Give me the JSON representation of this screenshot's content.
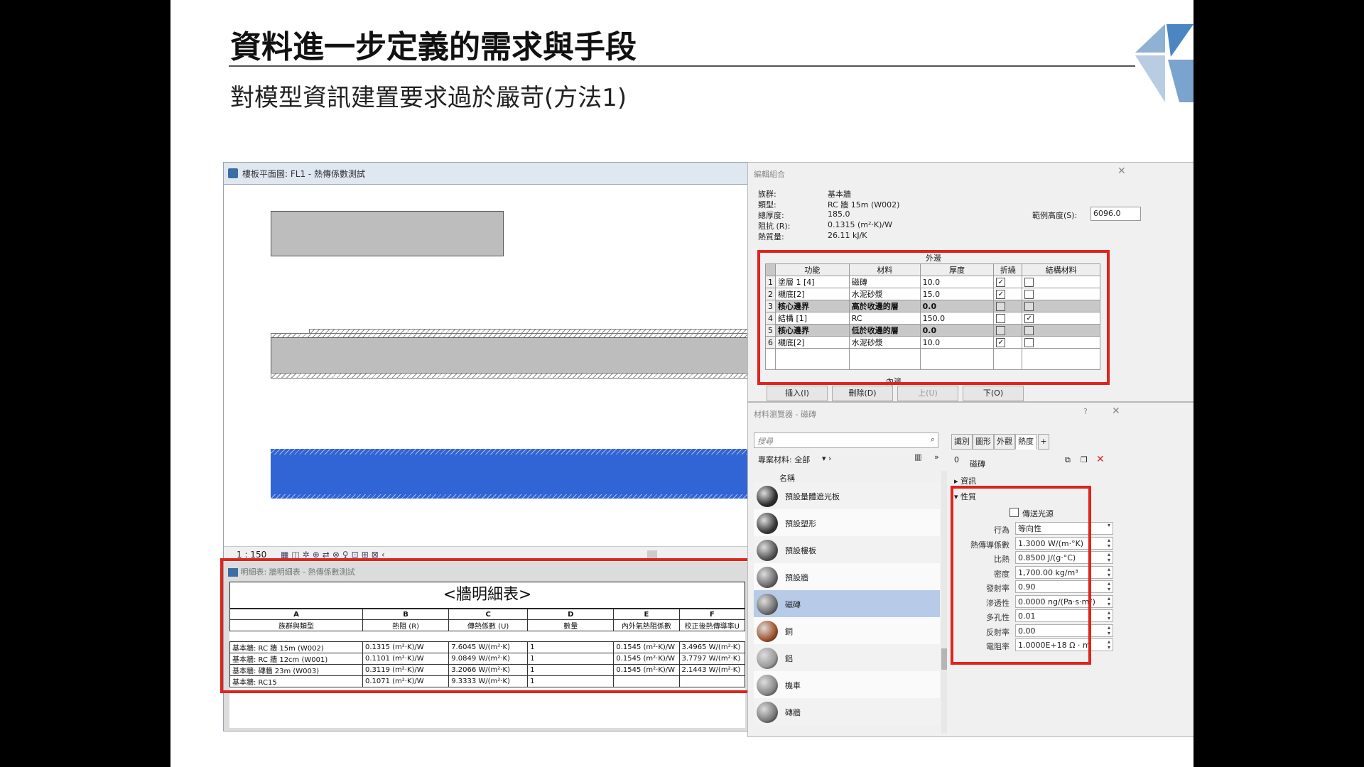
{
  "slide": {
    "title": "資料進一步定義的需求與手段",
    "subtitle": "對模型資訊建置要求過於嚴苛(方法1)"
  },
  "plan_view": {
    "title": "樓板平面圖: FL1 - 熱傳係數測試",
    "scale": "1 : 150"
  },
  "schedule": {
    "window_title": "明細表: 牆明細表 - 熱傳係數測試",
    "heading": "<牆明細表>",
    "col_letters": [
      "A",
      "B",
      "C",
      "D",
      "E",
      "F"
    ],
    "col_headers": [
      "族群與類型",
      "熱阻 (R)",
      "傳熱係數 (U)",
      "數量",
      "內外氣熱阻係數",
      "校正後熱傳導率U"
    ],
    "rows": [
      [
        "基本牆: RC 牆 15m (W002)",
        "0.1315 (m²·K)/W",
        "7.6045 W/(m²·K)",
        "1",
        "0.1545 (m²·K)/W",
        "3.4965 W/(m²·K)"
      ],
      [
        "基本牆: RC 牆 12cm (W001)",
        "0.1101 (m²·K)/W",
        "9.0849 W/(m²·K)",
        "1",
        "0.1545 (m²·K)/W",
        "3.7797 W/(m²·K)"
      ],
      [
        "基本牆: 磚牆 23m (W003)",
        "0.3119 (m²·K)/W",
        "3.2066 W/(m²·K)",
        "1",
        "0.1545 (m²·K)/W",
        "2.1443 W/(m²·K)"
      ],
      [
        "基本牆: RC15",
        "0.1071 (m²·K)/W",
        "9.3333 W/(m²·K)",
        "1",
        "",
        ""
      ]
    ]
  },
  "assembly": {
    "title": "編輯組合",
    "family_label": "族群:",
    "family_value": "基本牆",
    "type_label": "類型:",
    "type_value": "RC 牆 15m (W002)",
    "thickness_label": "總厚度:",
    "thickness_value": "185.0",
    "resistance_label": "阻抗 (R):",
    "resistance_value": "0.1315 (m²·K)/W",
    "mass_label": "熱質量:",
    "mass_value": "26.11 kJ/K",
    "sample_height_label": "範例高度(S):",
    "sample_height_value": "6096.0",
    "exterior_label": "外邊",
    "interior_label": "內邊",
    "headers": [
      "功能",
      "材料",
      "厚度",
      "折繞",
      "結構材料"
    ],
    "rows": [
      {
        "num": "1",
        "func": "塗層 1 [4]",
        "mat": "磁磚",
        "thk": "10.0",
        "wrap": true,
        "struct": false,
        "gray": false
      },
      {
        "num": "2",
        "func": "襯底[2]",
        "mat": "水泥砂漿",
        "thk": "15.0",
        "wrap": true,
        "struct": false,
        "gray": false
      },
      {
        "num": "3",
        "func": "核心邊界",
        "mat": "高於收邊的層",
        "thk": "0.0",
        "wrap": false,
        "struct": false,
        "gray": true
      },
      {
        "num": "4",
        "func": "結構 [1]",
        "mat": "RC",
        "thk": "150.0",
        "wrap": false,
        "struct": true,
        "gray": false
      },
      {
        "num": "5",
        "func": "核心邊界",
        "mat": "低於收邊的層",
        "thk": "0.0",
        "wrap": false,
        "struct": false,
        "gray": true
      },
      {
        "num": "6",
        "func": "襯底[2]",
        "mat": "水泥砂漿",
        "thk": "10.0",
        "wrap": true,
        "struct": false,
        "gray": false
      }
    ],
    "buttons": [
      "插入(I)",
      "刪除(D)",
      "上(U)",
      "下(O)"
    ]
  },
  "material_browser": {
    "title": "材料瀏覽器 - 磁磚",
    "search_placeholder": "搜尋",
    "filter_label": "專案材料: 全部",
    "list_header": "名稱",
    "items": [
      "預設量體遮光板",
      "預設塑形",
      "預設樓板",
      "預設牆",
      "磁磚",
      "銅",
      "鋁",
      "機車",
      "磚牆"
    ],
    "selected_index": 4,
    "tabs": [
      "識別",
      "圖形",
      "外觀",
      "熱度",
      "+"
    ],
    "active_tab": 3,
    "asset_name": "磁磚",
    "asset_count": "0",
    "section_info": "資訊",
    "section_props": "性質",
    "transmits_light": "傳送光源",
    "props": [
      {
        "label": "行為",
        "value": "等向性"
      },
      {
        "label": "熱傳導係數",
        "value": "1.3000 W/(m·°K)"
      },
      {
        "label": "比熱",
        "value": "0.8500 J/(g·°C)"
      },
      {
        "label": "密度",
        "value": "1,700.00 kg/m³"
      },
      {
        "label": "發射率",
        "value": "0.90"
      },
      {
        "label": "滲透性",
        "value": "0.0000 ng/(Pa·s·m²)"
      },
      {
        "label": "多孔性",
        "value": "0.01"
      },
      {
        "label": "反射率",
        "value": "0.00"
      },
      {
        "label": "電阻率",
        "value": "1.0000E+18 Ω · m"
      }
    ]
  },
  "colors": {
    "highlight_red": "#e0231c",
    "wall_blue": "#3164d4",
    "selection_blue": "#b7cbe8"
  }
}
